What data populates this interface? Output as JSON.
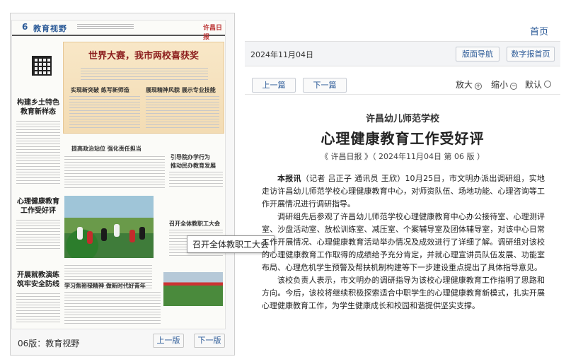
{
  "paper": {
    "masthead_no": "6",
    "masthead_name": "教育视野",
    "masthead_logo": "许昌日报",
    "banner_title": "世界大赛，我市两校喜获奖",
    "sub_left": "实现新突破 练写新师造",
    "sub_right": "展现精神风貌 展示专业技能",
    "side_heads": [
      "构建乡土特色",
      "教育新样态",
      "心理健康教育",
      "工作受好评",
      "开展就教演练",
      "筑牢安全防线"
    ],
    "mid_heads": [
      "提高政治站位 强化责任担当",
      "引导院办学行为",
      "推动民办教育发展",
      "召开全体教职工大会",
      "学习焦裕禄精神 做新时代好青年"
    ]
  },
  "page_footer": {
    "edition_label": "06版：教育视野",
    "prev_label": "上一版",
    "next_label": "下一版"
  },
  "tooltip": "召开全体教职工大会",
  "header": {
    "home_label": "首页",
    "date": "2024年11月04日",
    "layout_nav_label": "版面导航",
    "digital_home_label": "数字报首页",
    "prev_article_label": "上一篇",
    "next_article_label": "下一篇",
    "zoom_in_label": "放大",
    "zoom_out_label": "缩小",
    "default_label": "默认"
  },
  "article": {
    "kicker": "许昌幼儿师范学校",
    "title": "心理健康教育工作受好评",
    "meta": "《 许昌日报 》（ 2024年11月04日 第 06 版 ）",
    "lead": "本报讯",
    "p1": "（记者 吕正子 通讯员 王欣）10月25日，市文明办派出调研组，实地走访许昌幼儿师范学校心理健康教育中心，对师资队伍、场地功能、心理咨询等工作开展情况进行调研指导。",
    "p2": "调研组先后参观了许昌幼儿师范学校心理健康教育中心办公接待室、心理测评室、沙盘活动室、放松训练室、减压室、个案辅导室及团体辅导室，对该中心日常工作开展情况、心理健康教育活动举办情况及成效进行了详细了解。调研组对该校的心理健康教育工作取得的成绩给予充分肯定，并就心理宣讲员队伍发展、功能室布局、心理危机学生预警及帮扶机制构建等下一步建设重点提出了具体指导意见。",
    "p3": "该校负责人表示，市文明办的调研指导为该校心理健康教育工作指明了思路和方向。今后，该校将继续积极探索适合中职学生的心理健康教育新模式，扎实开展心理健康教育工作，为学生健康成长和校园和谐提供坚实支撑。"
  }
}
